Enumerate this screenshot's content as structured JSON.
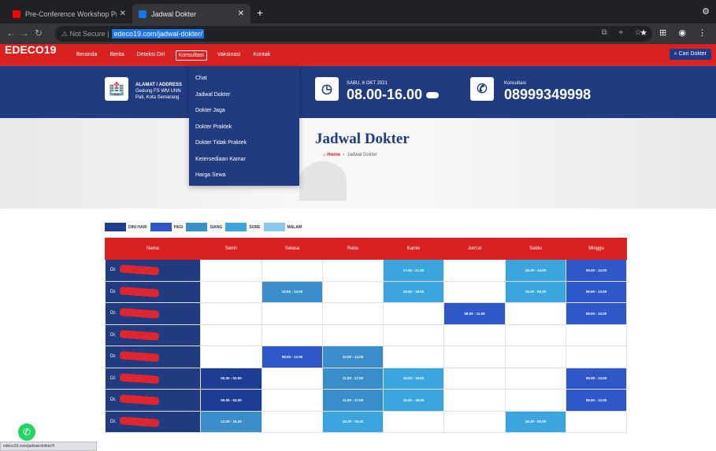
{
  "browser": {
    "tabs": [
      {
        "title": "Pre-Conference Workshop Pr...",
        "color": "#ff0000"
      },
      {
        "title": "Jadwal Dokter",
        "color": "#1a73e8"
      }
    ],
    "security_label": "Not Secure",
    "url": "edeco19.com/jadwal-dokter/"
  },
  "site": {
    "logo": "EDECO19",
    "menu": [
      "Beranda",
      "Berita",
      "Deteksi Diri",
      "Konsultasi",
      "Vaksinasi",
      "Kontak"
    ],
    "search_button": "Cari Dokter",
    "address": {
      "label": "ALAMAT / ADDRESS",
      "line1": "Gedung FS WM UNN",
      "line2": "Pati, Kota Semarang"
    },
    "hours": {
      "date": "SABU, 6 OKT 2021",
      "time": "08.00-16.00"
    },
    "consult": {
      "label": "Konsultasi",
      "phone": "08999349998"
    },
    "dropdown": [
      "Chat",
      "Jadwal Dokter",
      "Dokter Jaga",
      "Dokter Praktek",
      "Dokter Tidak Praktek",
      "Ketersediaan Kamar",
      "Harga Sewa"
    ]
  },
  "page": {
    "title": "Jadwal Dokter",
    "breadcrumb_home": "Home",
    "breadcrumb_current": "Jadwal Dokter"
  },
  "legend": [
    {
      "label": "DINI HARI",
      "color": "#1d3c93"
    },
    {
      "label": "PAGI",
      "color": "#2f57c8"
    },
    {
      "label": "SIANG",
      "color": "#3a8ec9"
    },
    {
      "label": "SORE",
      "color": "#3aa6dd"
    },
    {
      "label": "MALAM",
      "color": "#8cc7ec"
    }
  ],
  "schedule": {
    "headers": [
      "Nama",
      "Senin",
      "Selasa",
      "Rabu",
      "Kamis",
      "Jum'at",
      "Sabtu",
      "Minggu"
    ],
    "rows": [
      {
        "name": "Dr.",
        "cells": [
          "",
          "",
          "",
          "17.00 - 21.00",
          "",
          "16.30 - 14.00",
          "09.00 - 13.00"
        ]
      },
      {
        "name": "Dr.",
        "cells": [
          "",
          "10.00 - 14.00",
          "",
          "15.00 - 19.00",
          "",
          "16.30 - 00.00",
          "08.00 - 13.00"
        ]
      },
      {
        "name": "Dr.",
        "cells": [
          "",
          "",
          "",
          "",
          "08.00 - 11.00",
          "",
          "08.00 - 13.00"
        ]
      },
      {
        "name": "Dr.",
        "cells": [
          "",
          "",
          "",
          "",
          "",
          "",
          ""
        ]
      },
      {
        "name": "Dr.",
        "cells": [
          "",
          "08.00 - 12.00",
          "10.00 - 14.00",
          "",
          "",
          "",
          ""
        ]
      },
      {
        "name": "Dr.",
        "cells": [
          "00.30 - 02.00",
          "",
          "11.00 - 17.00",
          "15.00 - 19.00",
          "",
          "",
          "09.00 - 13.00"
        ]
      },
      {
        "name": "Dr.",
        "cells": [
          "00.00 - 02.00",
          "",
          "11.00 - 17.00",
          "15.00 - 19.00",
          "",
          "",
          "08.00 - 13.00"
        ]
      },
      {
        "name": "Dr.",
        "cells": [
          "12.00 - 15.30",
          "",
          "16.30 - 19.30",
          "",
          "",
          "16.30 - 00.00",
          ""
        ]
      }
    ],
    "cell_colors": [
      [
        "",
        "",
        "",
        "#3aa6dd",
        "",
        "#3aa6dd",
        "#2f57c8"
      ],
      [
        "",
        "#3a8ec9",
        "",
        "#3aa6dd",
        "",
        "#3aa6dd",
        "#2f57c8"
      ],
      [
        "",
        "",
        "",
        "",
        "#2f57c8",
        "",
        "#2f57c8"
      ],
      [
        "",
        "",
        "",
        "",
        "",
        "",
        ""
      ],
      [
        "",
        "#2f57c8",
        "#3a8ec9",
        "",
        "",
        "",
        ""
      ],
      [
        "#1d3c93",
        "",
        "#3a8ec9",
        "#3aa6dd",
        "",
        "",
        "#2f57c8"
      ],
      [
        "#1d3c93",
        "",
        "#3a8ec9",
        "#3aa6dd",
        "",
        "",
        "#2f57c8"
      ],
      [
        "#3a8ec9",
        "",
        "#3aa6dd",
        "",
        "",
        "#3aa6dd",
        ""
      ]
    ]
  },
  "status_url": "edeco19.com/jadwal-dokter/#"
}
